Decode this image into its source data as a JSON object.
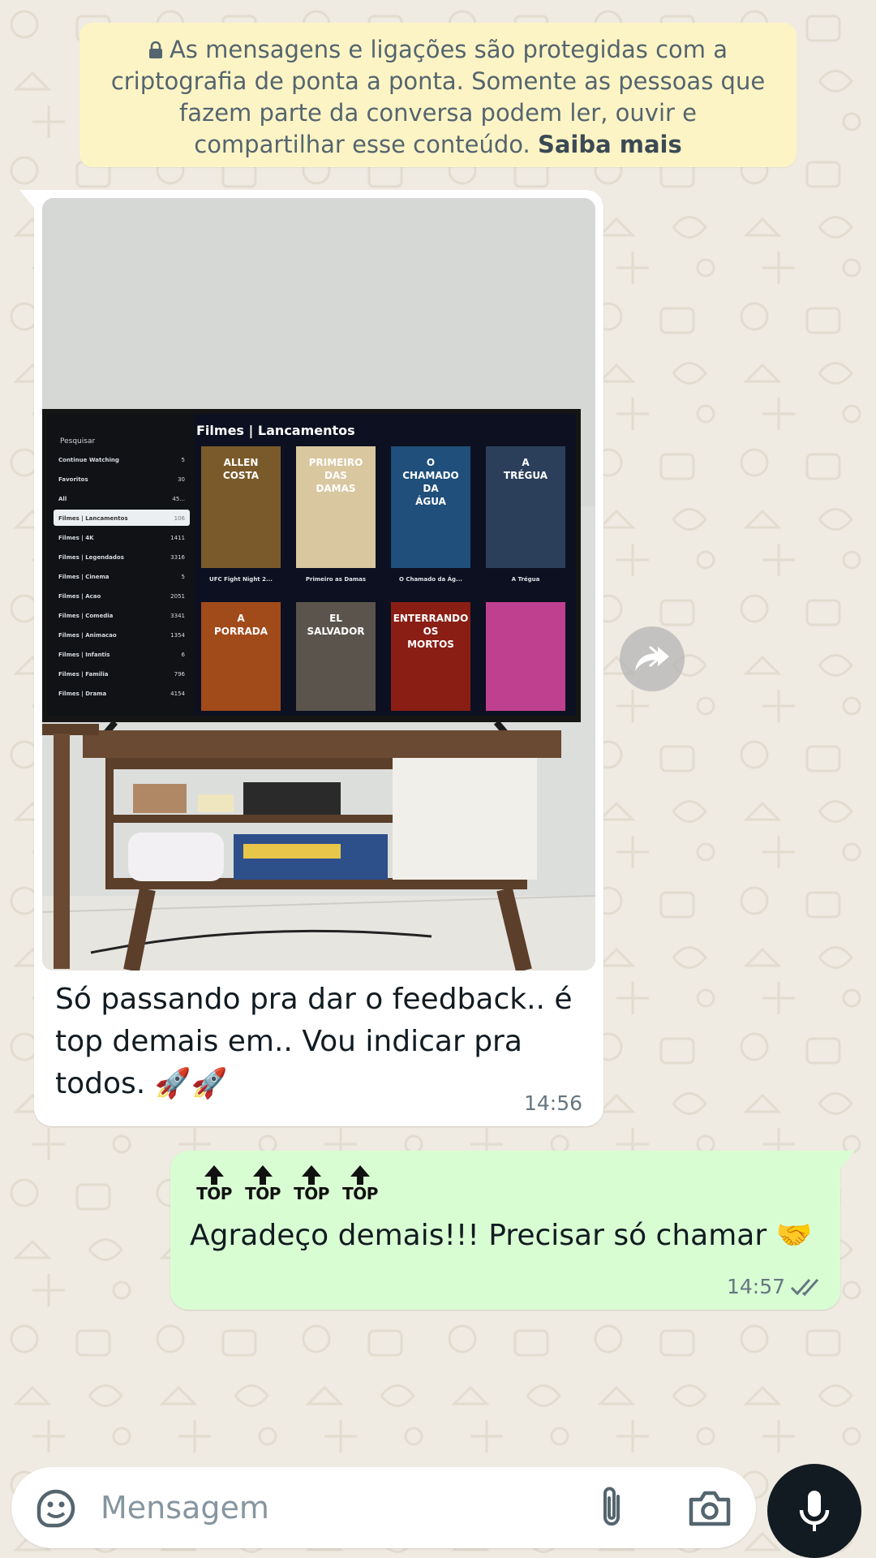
{
  "encryption_notice": {
    "text": "As mensagens e ligações são protegidas com a criptografia de ponta a ponta. Somente as pessoas que fazem parte da conversa podem ler, ouvir e compartilhar esse conteúdo.",
    "learn_more": "Saiba mais"
  },
  "messages": [
    {
      "direction": "incoming",
      "photo": {
        "tv_header": "Filmes | Lancamentos",
        "tv_search": "Pesquisar",
        "tv_menu": [
          {
            "label": "Continue Watching",
            "count": "5"
          },
          {
            "label": "Favoritos",
            "count": "30"
          },
          {
            "label": "All",
            "count": "45..."
          },
          {
            "label": "Filmes | Lancamentos",
            "count": "106"
          },
          {
            "label": "Filmes | 4K",
            "count": "1411"
          },
          {
            "label": "Filmes | Legendados",
            "count": "3316"
          },
          {
            "label": "Filmes | Cinema",
            "count": "5"
          },
          {
            "label": "Filmes | Acao",
            "count": "2051"
          },
          {
            "label": "Filmes | Comedia",
            "count": "3341"
          },
          {
            "label": "Filmes | Animacao",
            "count": "1354"
          },
          {
            "label": "Filmes | Infantis",
            "count": "6"
          },
          {
            "label": "Filmes | Familia",
            "count": "796"
          },
          {
            "label": "Filmes | Drama",
            "count": "4154"
          }
        ],
        "tv_posters": [
          {
            "title": "ALLEN COSTA",
            "caption": "UFC Fight Night 2...",
            "color": "#7a5a2a"
          },
          {
            "title": "PRIMEIRO DAS DAMAS",
            "caption": "Primeiro as Damas",
            "color": "#d9c7a0"
          },
          {
            "title": "O CHAMADO DA ÁGUA",
            "caption": "O Chamado da Ág...",
            "color": "#1f4f7a"
          },
          {
            "title": "A TRÉGUA",
            "caption": "A Trégua",
            "color": "#2b3e5a"
          },
          {
            "title": "A PORRADA",
            "caption": "",
            "color": "#a14a1a"
          },
          {
            "title": "EL SALVADOR",
            "caption": "",
            "color": "#5a544c"
          },
          {
            "title": "ENTERRANDO OS MORTOS",
            "caption": "",
            "color": "#8a1e14"
          },
          {
            "title": "",
            "caption": "",
            "color": "#c04090"
          }
        ]
      },
      "text": "Só passando pra dar o feedback.. é top demais em.. Vou indicar pra todos. 🚀🚀",
      "time": "14:56"
    },
    {
      "direction": "outgoing",
      "top_label": "TOP",
      "text": "Agradeço demais!!! Precisar só chamar 🤝",
      "time": "14:57",
      "status": "read"
    }
  ],
  "composer": {
    "placeholder": "Mensagem"
  },
  "colors": {
    "background": "#efeae2",
    "incoming_bubble": "#ffffff",
    "outgoing_bubble": "#d9fdd3",
    "notice_bg": "#fdf4c5",
    "read_ticks": "#667781",
    "mic_button": "#111b21"
  },
  "icons": [
    "lock-icon",
    "forward-icon",
    "double-check-icon",
    "sticker-icon",
    "attach-icon",
    "camera-icon",
    "mic-icon"
  ]
}
